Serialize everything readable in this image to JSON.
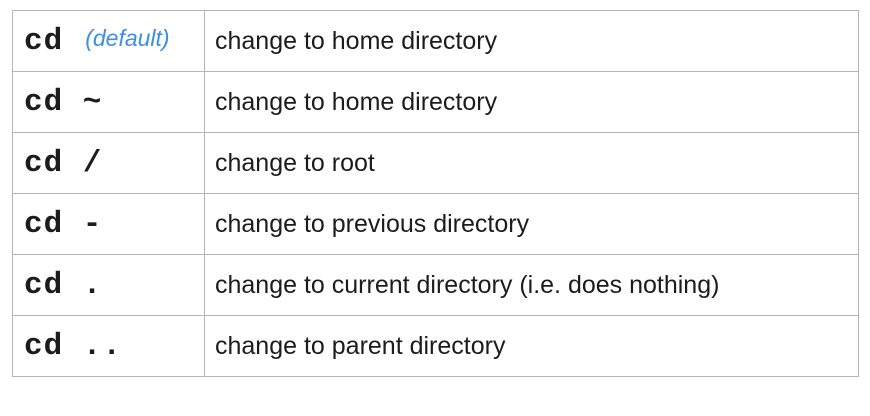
{
  "note_color": "#3d8fe0",
  "rows": [
    {
      "command": "cd",
      "note": "(default)",
      "description": "change to home directory"
    },
    {
      "command": "cd ~",
      "description": "change to home directory"
    },
    {
      "command": "cd /",
      "description": "change to root"
    },
    {
      "command": "cd -",
      "description": "change to previous directory"
    },
    {
      "command": "cd .",
      "description": "change to current directory (i.e. does nothing)"
    },
    {
      "command": "cd ..",
      "description": "change to parent directory"
    }
  ]
}
